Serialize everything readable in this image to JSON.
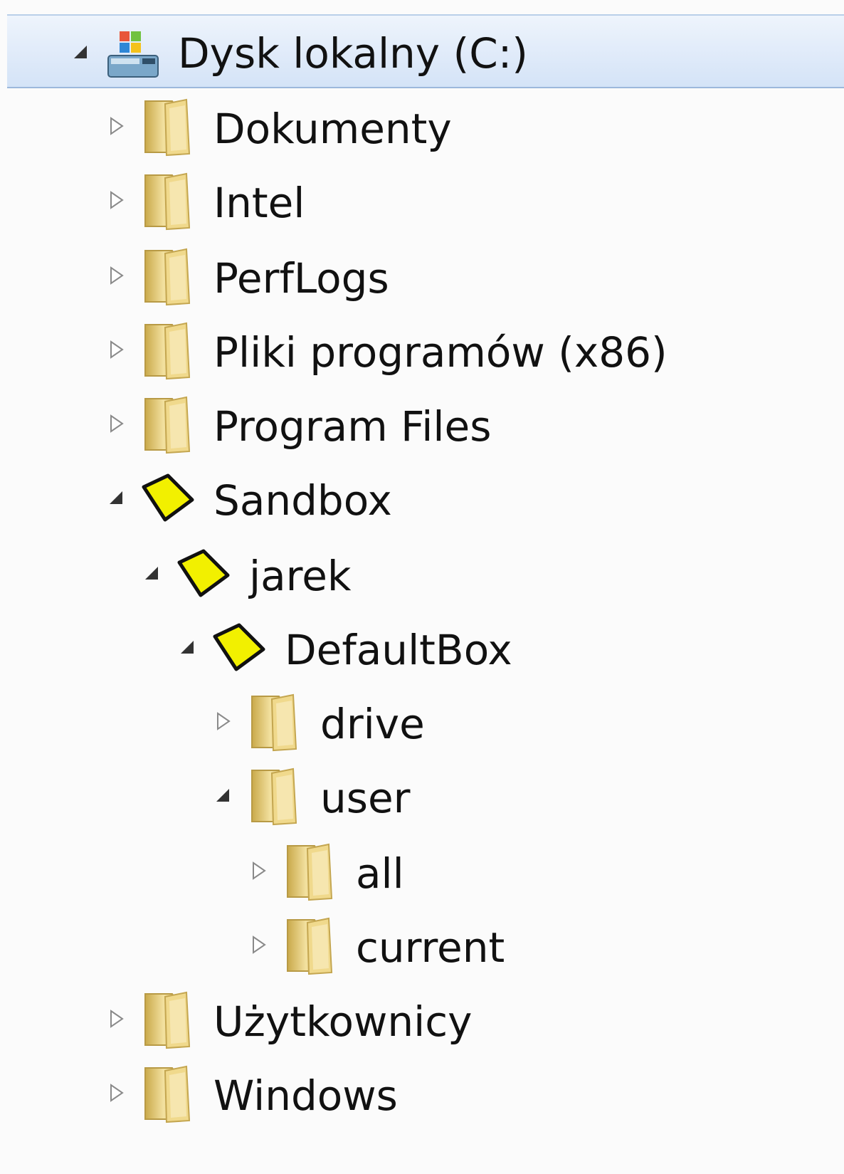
{
  "tree": {
    "items": [
      {
        "label": "Dysk lokalny (C:)",
        "depth": 0,
        "expanded": true,
        "icon": "drive-icon",
        "selected": true
      },
      {
        "label": "Dokumenty",
        "depth": 1,
        "expanded": false,
        "icon": "folder-icon"
      },
      {
        "label": "Intel",
        "depth": 1,
        "expanded": false,
        "icon": "folder-icon"
      },
      {
        "label": "PerfLogs",
        "depth": 1,
        "expanded": false,
        "icon": "folder-icon"
      },
      {
        "label": "Pliki programów (x86)",
        "depth": 1,
        "expanded": false,
        "icon": "folder-icon"
      },
      {
        "label": "Program Files",
        "depth": 1,
        "expanded": false,
        "icon": "folder-icon"
      },
      {
        "label": "Sandbox",
        "depth": 1,
        "expanded": true,
        "icon": "sandbox-icon"
      },
      {
        "label": "jarek",
        "depth": 2,
        "expanded": true,
        "icon": "sandbox-icon"
      },
      {
        "label": "DefaultBox",
        "depth": 3,
        "expanded": true,
        "icon": "sandbox-icon"
      },
      {
        "label": "drive",
        "depth": 4,
        "expanded": false,
        "icon": "folder-icon"
      },
      {
        "label": "user",
        "depth": 4,
        "expanded": true,
        "icon": "folder-icon"
      },
      {
        "label": "all",
        "depth": 5,
        "expanded": false,
        "icon": "folder-icon"
      },
      {
        "label": "current",
        "depth": 5,
        "expanded": false,
        "icon": "folder-icon"
      },
      {
        "label": "Użytkownicy",
        "depth": 1,
        "expanded": false,
        "icon": "folder-icon"
      },
      {
        "label": "Windows",
        "depth": 1,
        "expanded": false,
        "icon": "folder-icon"
      }
    ],
    "colors": {
      "selection": "#d4e3f7",
      "folder": "#e8cf7a",
      "sandbox": "#f2f000"
    }
  }
}
